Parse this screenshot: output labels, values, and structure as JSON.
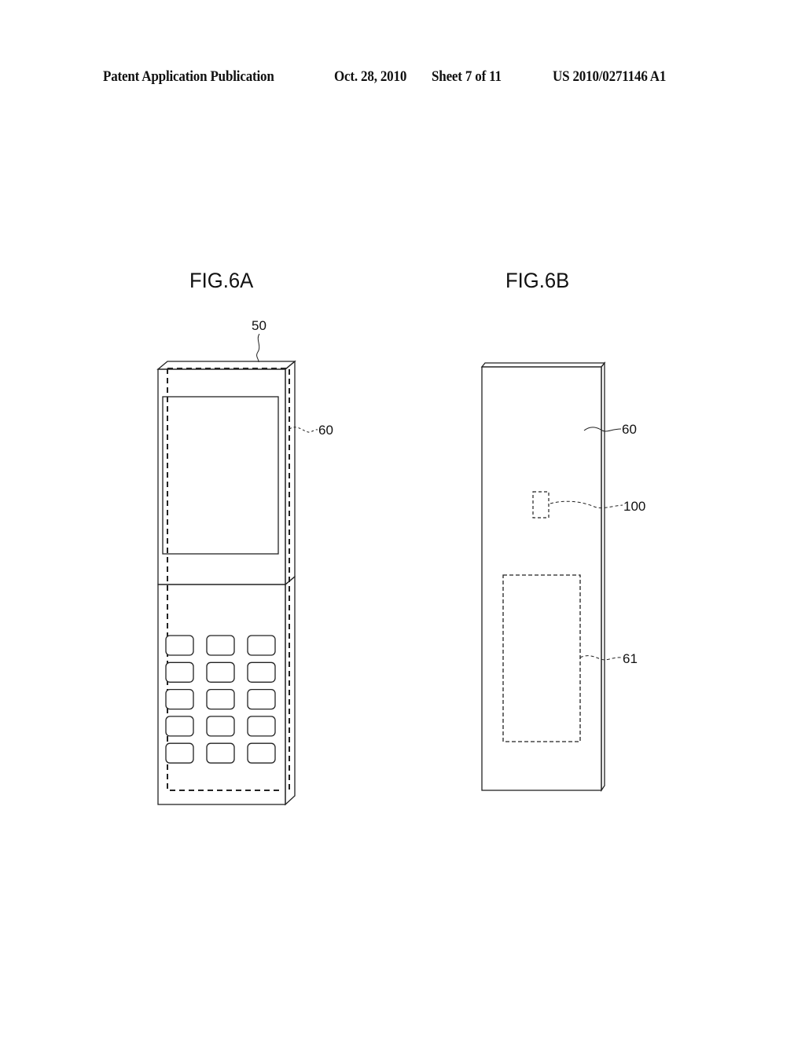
{
  "header": {
    "publication": "Patent Application Publication",
    "date": "Oct. 28, 2010",
    "sheet": "Sheet 7 of 11",
    "number": "US 2010/0271146 A1"
  },
  "figures": [
    {
      "label": "FIG.6A",
      "description": "front view of folding mobile phone with display and keypad",
      "keypad": {
        "rows": 5,
        "columns": 3
      },
      "reference_labels": [
        {
          "id": "50",
          "text": "50"
        },
        {
          "id": "60",
          "text": "60"
        }
      ]
    },
    {
      "label": "FIG.6B",
      "description": "rear view of housing with hidden component and region",
      "reference_labels": [
        {
          "id": "60",
          "text": "60"
        },
        {
          "id": "100",
          "text": "100"
        },
        {
          "id": "61",
          "text": "61"
        }
      ]
    }
  ]
}
